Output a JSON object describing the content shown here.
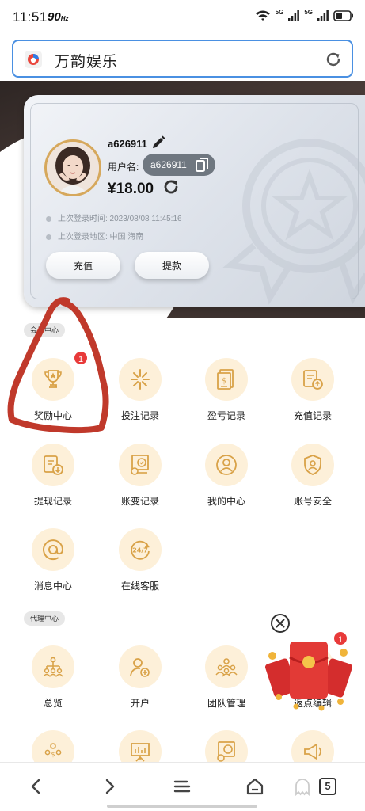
{
  "status_bar": {
    "time": "11:51",
    "refresh_rate": "90",
    "refresh_unit": "Hz",
    "signal_1": "5G",
    "signal_2": "5G"
  },
  "search": {
    "text": "万韵娱乐"
  },
  "profile": {
    "username": "a626911",
    "username_label": "用户名:",
    "username_value": "a626911",
    "balance": "¥18.00",
    "last_login_time": "上次登录时间: 2023/08/08 11:45:16",
    "last_login_region": "上次登录地区: 中国 海南",
    "deposit_label": "充值",
    "withdraw_label": "提款"
  },
  "member_center": {
    "title": "会员中心",
    "items": [
      {
        "label": "奖励中心",
        "icon": "trophy-icon",
        "badge": "1"
      },
      {
        "label": "投注记录",
        "icon": "bet-record-icon"
      },
      {
        "label": "盈亏记录",
        "icon": "profit-record-icon"
      },
      {
        "label": "充值记录",
        "icon": "deposit-record-icon"
      },
      {
        "label": "提现记录",
        "icon": "withdraw-record-icon"
      },
      {
        "label": "账变记录",
        "icon": "account-change-icon"
      },
      {
        "label": "我的中心",
        "icon": "user-center-icon"
      },
      {
        "label": "账号安全",
        "icon": "security-icon"
      },
      {
        "label": "消息中心",
        "icon": "at-icon"
      },
      {
        "label": "在线客服",
        "icon": "service-24-7-icon"
      }
    ]
  },
  "agent_center": {
    "title": "代理中心",
    "items": [
      {
        "label": "总览",
        "icon": "overview-icon"
      },
      {
        "label": "开户",
        "icon": "add-account-icon"
      },
      {
        "label": "团队管理",
        "icon": "team-icon"
      },
      {
        "label": "返点编辑",
        "icon": "rebate-icon"
      }
    ]
  },
  "floating": {
    "badge": "1"
  },
  "bottom_nav": {
    "tab_count": "5"
  },
  "colors": {
    "accent": "#d9a248",
    "icon_bg": "#fdf0d9",
    "badge": "#e83a3a",
    "search_border": "#4a90e2"
  }
}
